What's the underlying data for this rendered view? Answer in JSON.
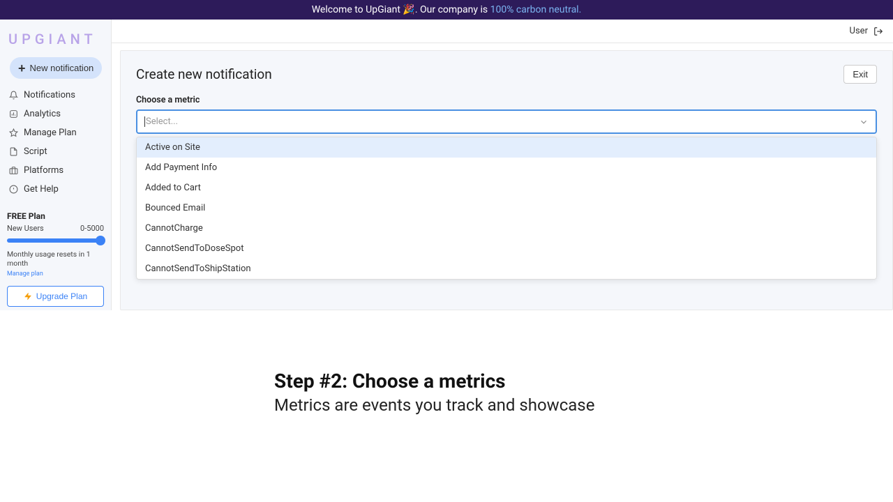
{
  "banner": {
    "prefix": "Welcome to UpGiant 🎉. Our company is ",
    "link": "100% carbon neutral."
  },
  "logo": "UPGIANT",
  "newNotification": "New notification",
  "nav": [
    {
      "label": "Notifications"
    },
    {
      "label": "Analytics"
    },
    {
      "label": "Manage Plan"
    },
    {
      "label": "Script"
    },
    {
      "label": "Platforms"
    },
    {
      "label": "Get Help"
    }
  ],
  "plan": {
    "title": "FREE Plan",
    "metricLabel": "New Users",
    "metricValue": "0-5000",
    "note": "Monthly usage resets in 1 month",
    "manage": "Manage plan",
    "upgrade": "Upgrade Plan"
  },
  "topbar": {
    "user": "User"
  },
  "content": {
    "title": "Create new notification",
    "exit": "Exit",
    "fieldLabel": "Choose a metric",
    "placeholder": "Select...",
    "options": [
      "Active on Site",
      "Add Payment Info",
      "Added to Cart",
      "Bounced Email",
      "CannotCharge",
      "CannotSendToDoseSpot",
      "CannotSendToShipStation"
    ]
  },
  "tutorial": {
    "heading": "Step #2: Choose a metrics",
    "sub": "Metrics are events you track and showcase"
  }
}
